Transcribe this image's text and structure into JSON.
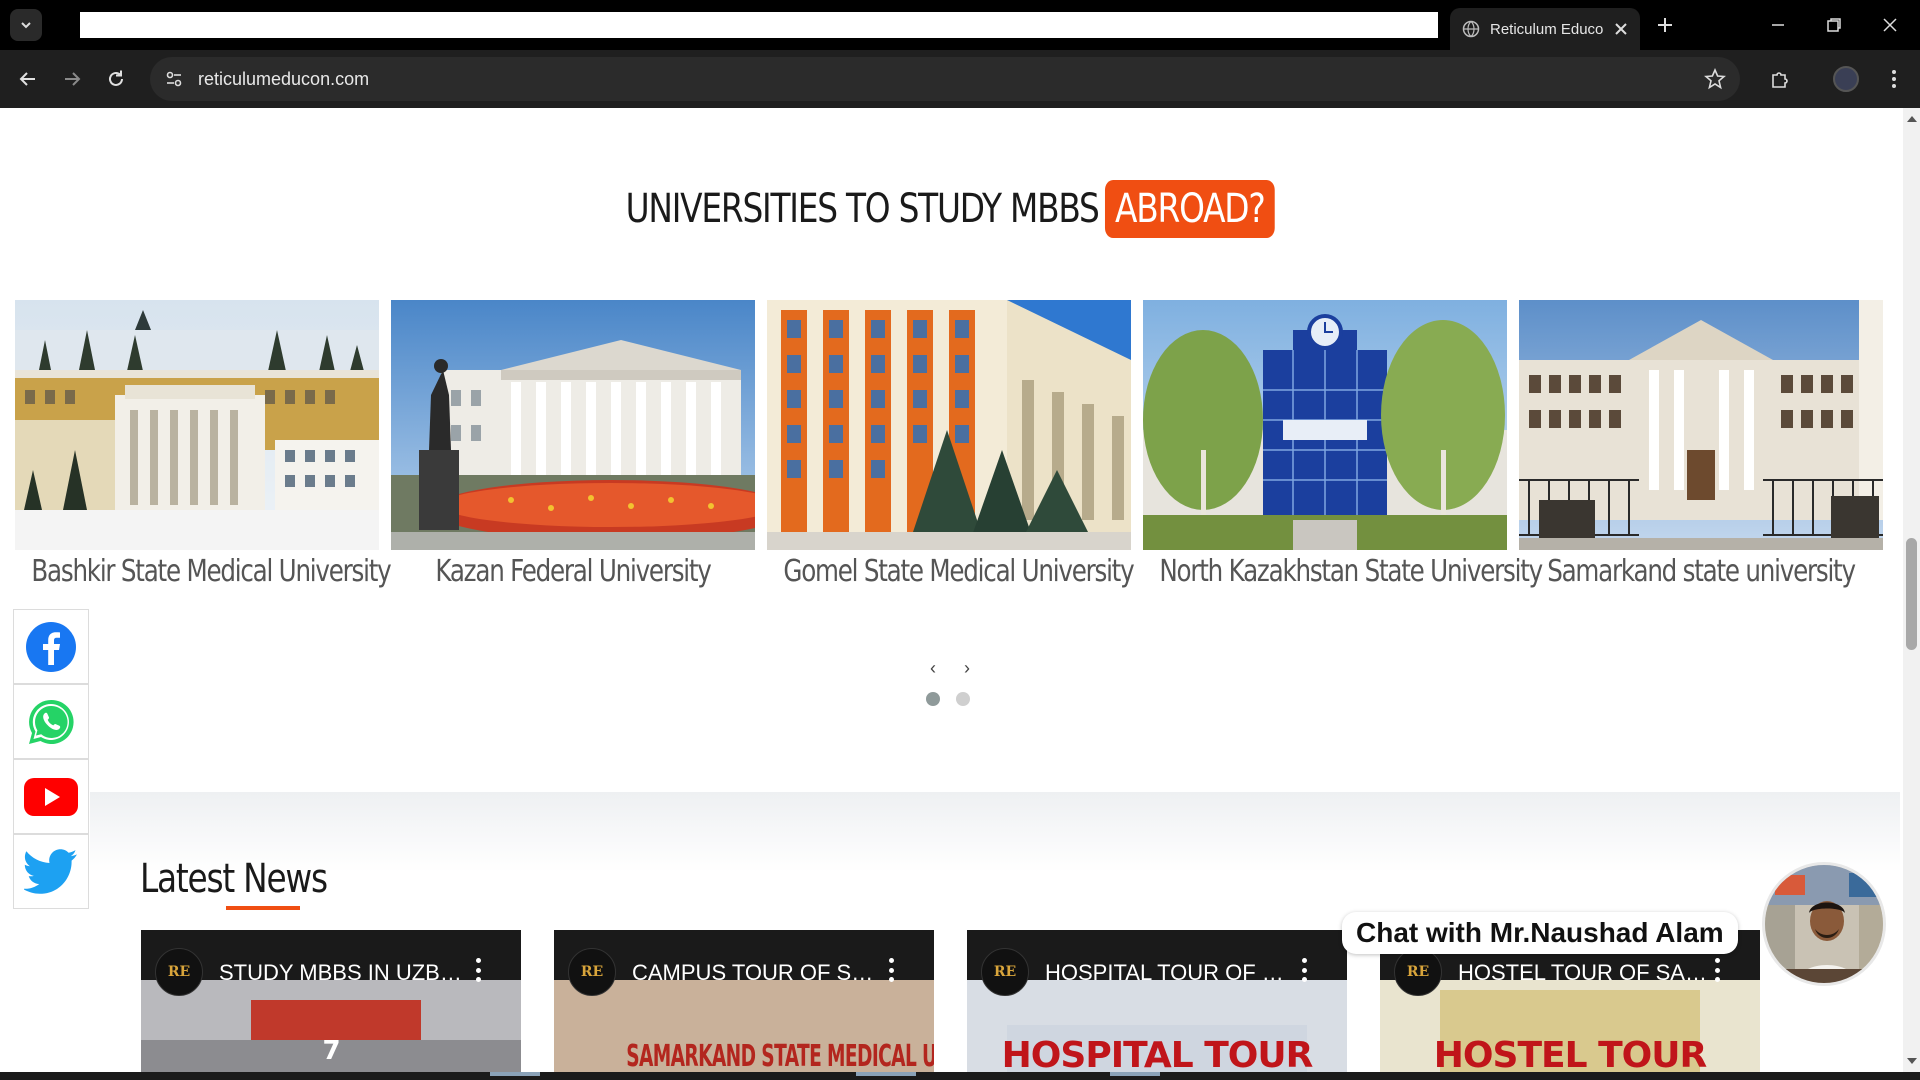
{
  "browser": {
    "tab_title": "Reticulum Educon",
    "url": "reticulumeducon.com"
  },
  "heading": {
    "text": "UNIVERSITIES TO STUDY MBBS",
    "highlight": "ABROAD?"
  },
  "universities": [
    {
      "name": "Bashkir State Medical University"
    },
    {
      "name": "Kazan Federal University"
    },
    {
      "name": "Gomel State Medical University"
    },
    {
      "name": "North Kazakhstan State University"
    },
    {
      "name": "Samarkand state university"
    }
  ],
  "carousel": {
    "prev_label": "‹",
    "next_label": "›",
    "pages": 2,
    "active_page": 1
  },
  "news": {
    "title": "Latest News",
    "videos": [
      {
        "title": "STUDY MBBS IN UZBEKISTAN",
        "overlay": "7"
      },
      {
        "title": "CAMPUS TOUR OF SAMARKAND STATE MEDICAL UNIVERSITY",
        "overlay": "SAMARKAND STATE MEDICAL UNIVERSITY"
      },
      {
        "title": "HOSPITAL TOUR OF SAMARKAND",
        "overlay": "HOSPITAL TOUR"
      },
      {
        "title": "HOSTEL TOUR OF SAMARKAND",
        "overlay": "HOSTEL TOUR"
      }
    ],
    "channel_logo": "RE"
  },
  "social": [
    {
      "name": "facebook",
      "icon": "facebook-icon"
    },
    {
      "name": "whatsapp",
      "icon": "whatsapp-icon"
    },
    {
      "name": "youtube",
      "icon": "youtube-icon"
    },
    {
      "name": "twitter",
      "icon": "twitter-icon"
    }
  ],
  "chat": {
    "label": "Chat with Mr.Naushad Alam"
  },
  "colors": {
    "accent": "#f04e12",
    "facebook": "#1877f2",
    "whatsapp": "#25d366",
    "youtube": "#ff0000",
    "twitter": "#1da1f2"
  }
}
